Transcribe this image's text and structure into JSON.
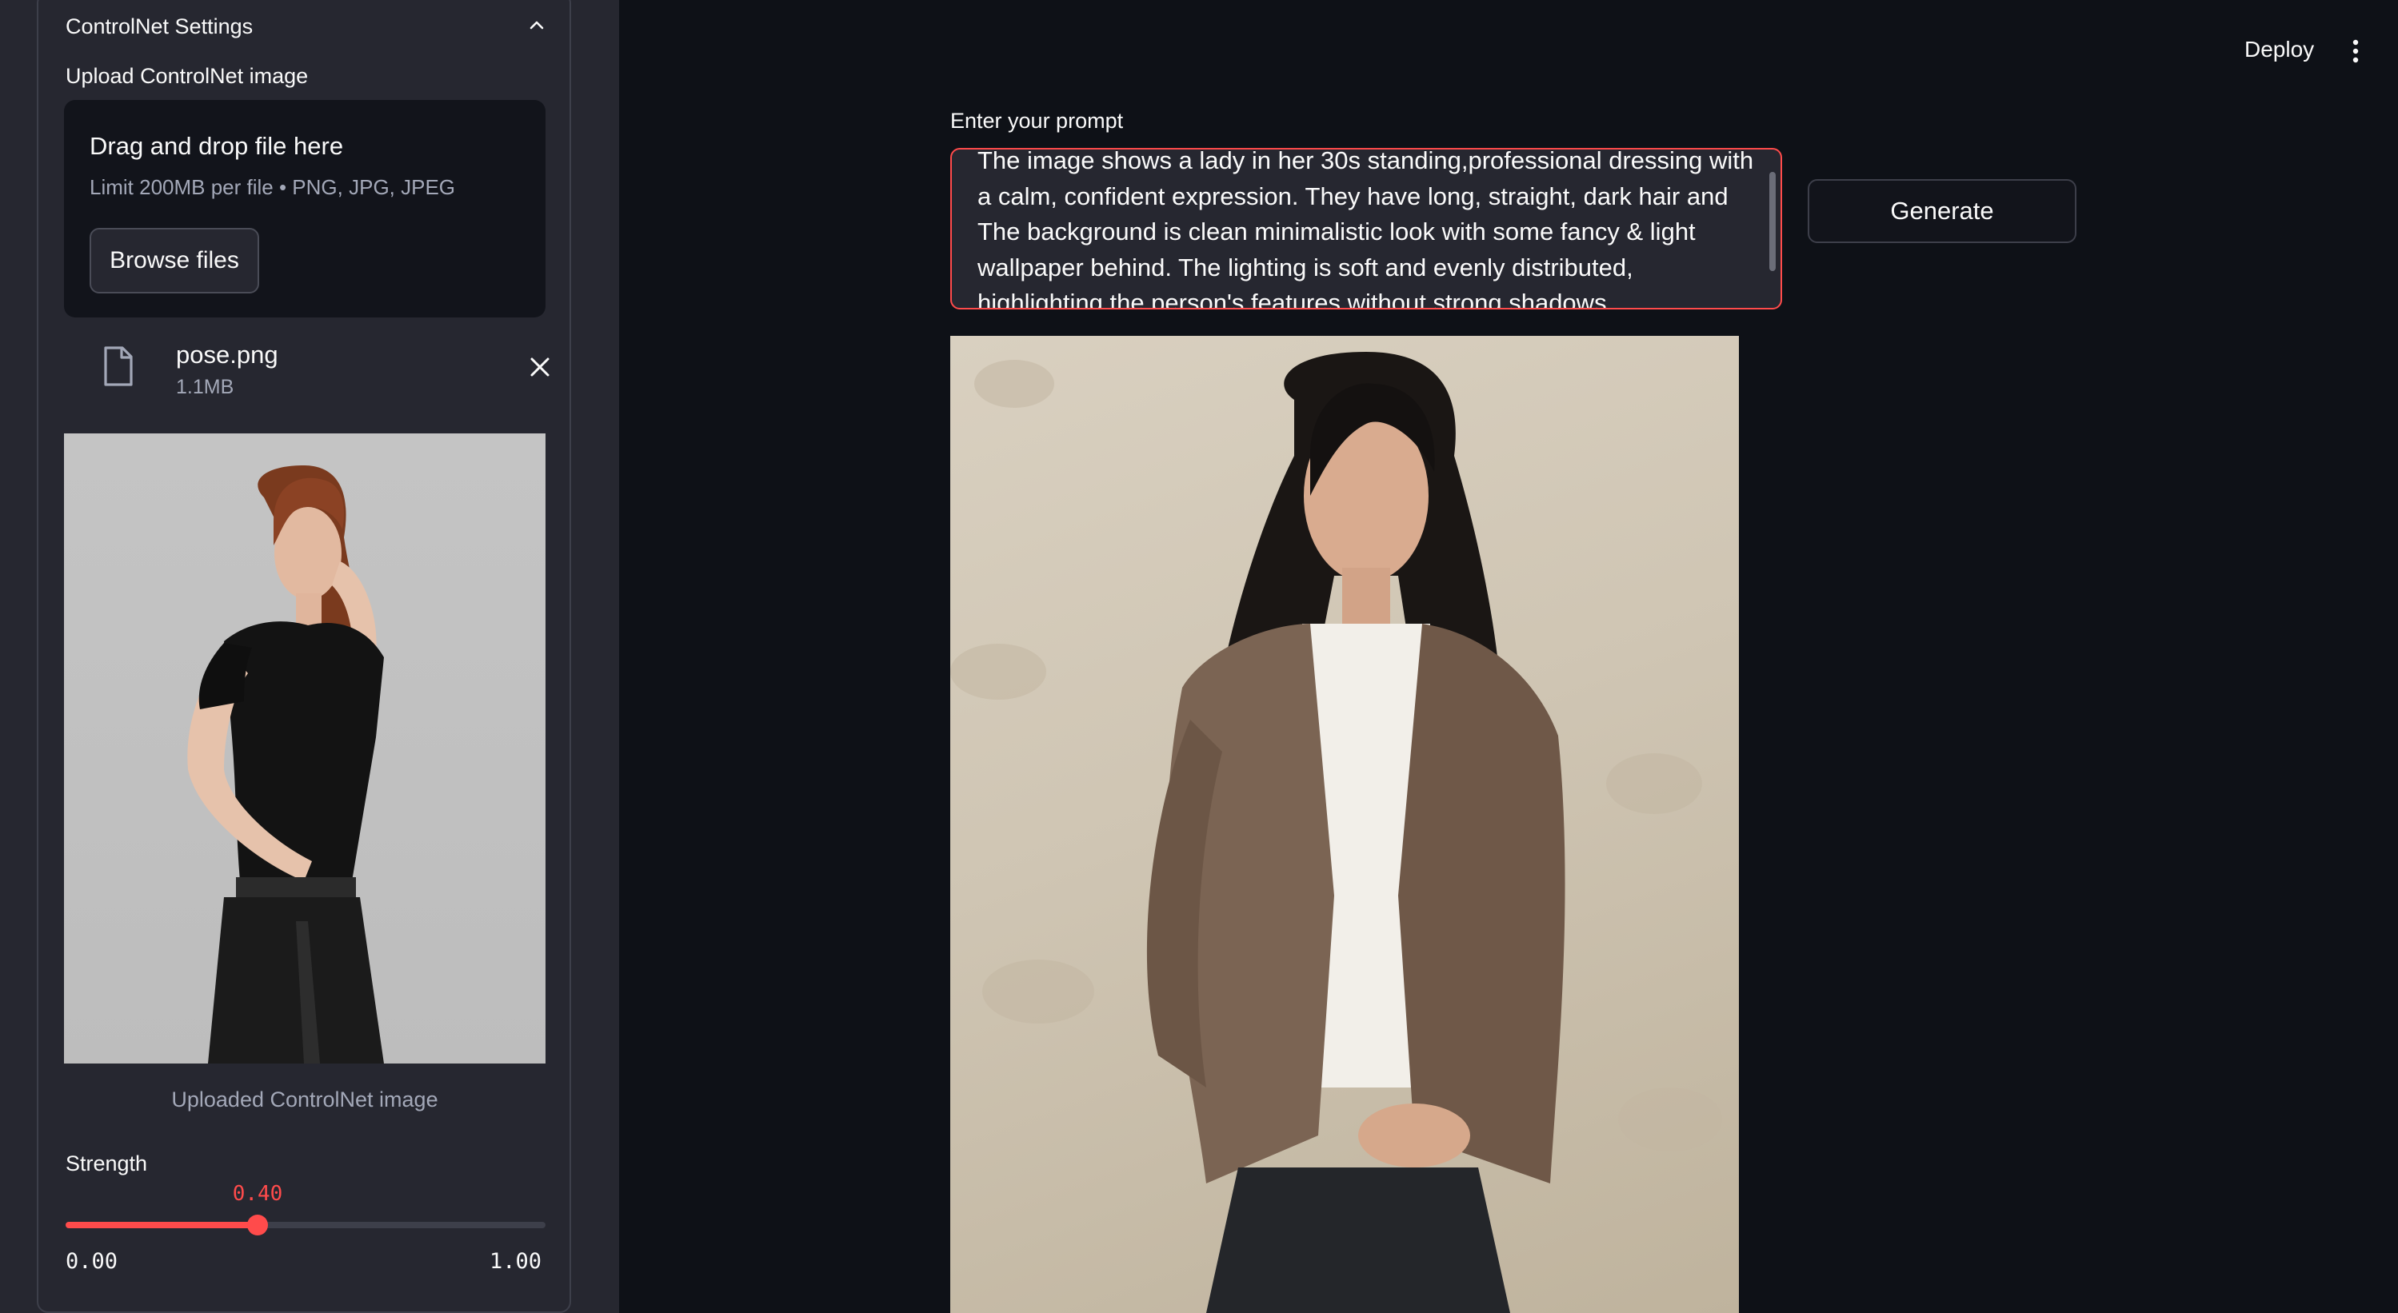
{
  "sidebar": {
    "expander_title": "ControlNet Settings",
    "upload_label": "Upload ControlNet image",
    "dropzone": {
      "title": "Drag and drop file here",
      "limit": "Limit 200MB per file • PNG, JPG, JPEG",
      "browse_label": "Browse files"
    },
    "file": {
      "name": "pose.png",
      "size": "1.1MB"
    },
    "image_caption": "Uploaded ControlNet image",
    "strength": {
      "label": "Strength",
      "value": "0.40",
      "min": "0.00",
      "max": "1.00",
      "fraction": 0.4
    }
  },
  "header": {
    "deploy_label": "Deploy"
  },
  "main": {
    "prompt_label": "Enter your prompt",
    "prompt_value": "The image shows a lady in her 30s standing,professional dressing with a calm, confident expression. They have long, straight, dark hair and The background is clean minimalistic look with some fancy & light wallpaper behind. The lighting is soft and evenly distributed, highlighting the person's features without strong shadows.",
    "generate_label": "Generate"
  },
  "colors": {
    "accent": "#ff4b4b",
    "background": "#0e1117",
    "sidebar": "#262730"
  }
}
